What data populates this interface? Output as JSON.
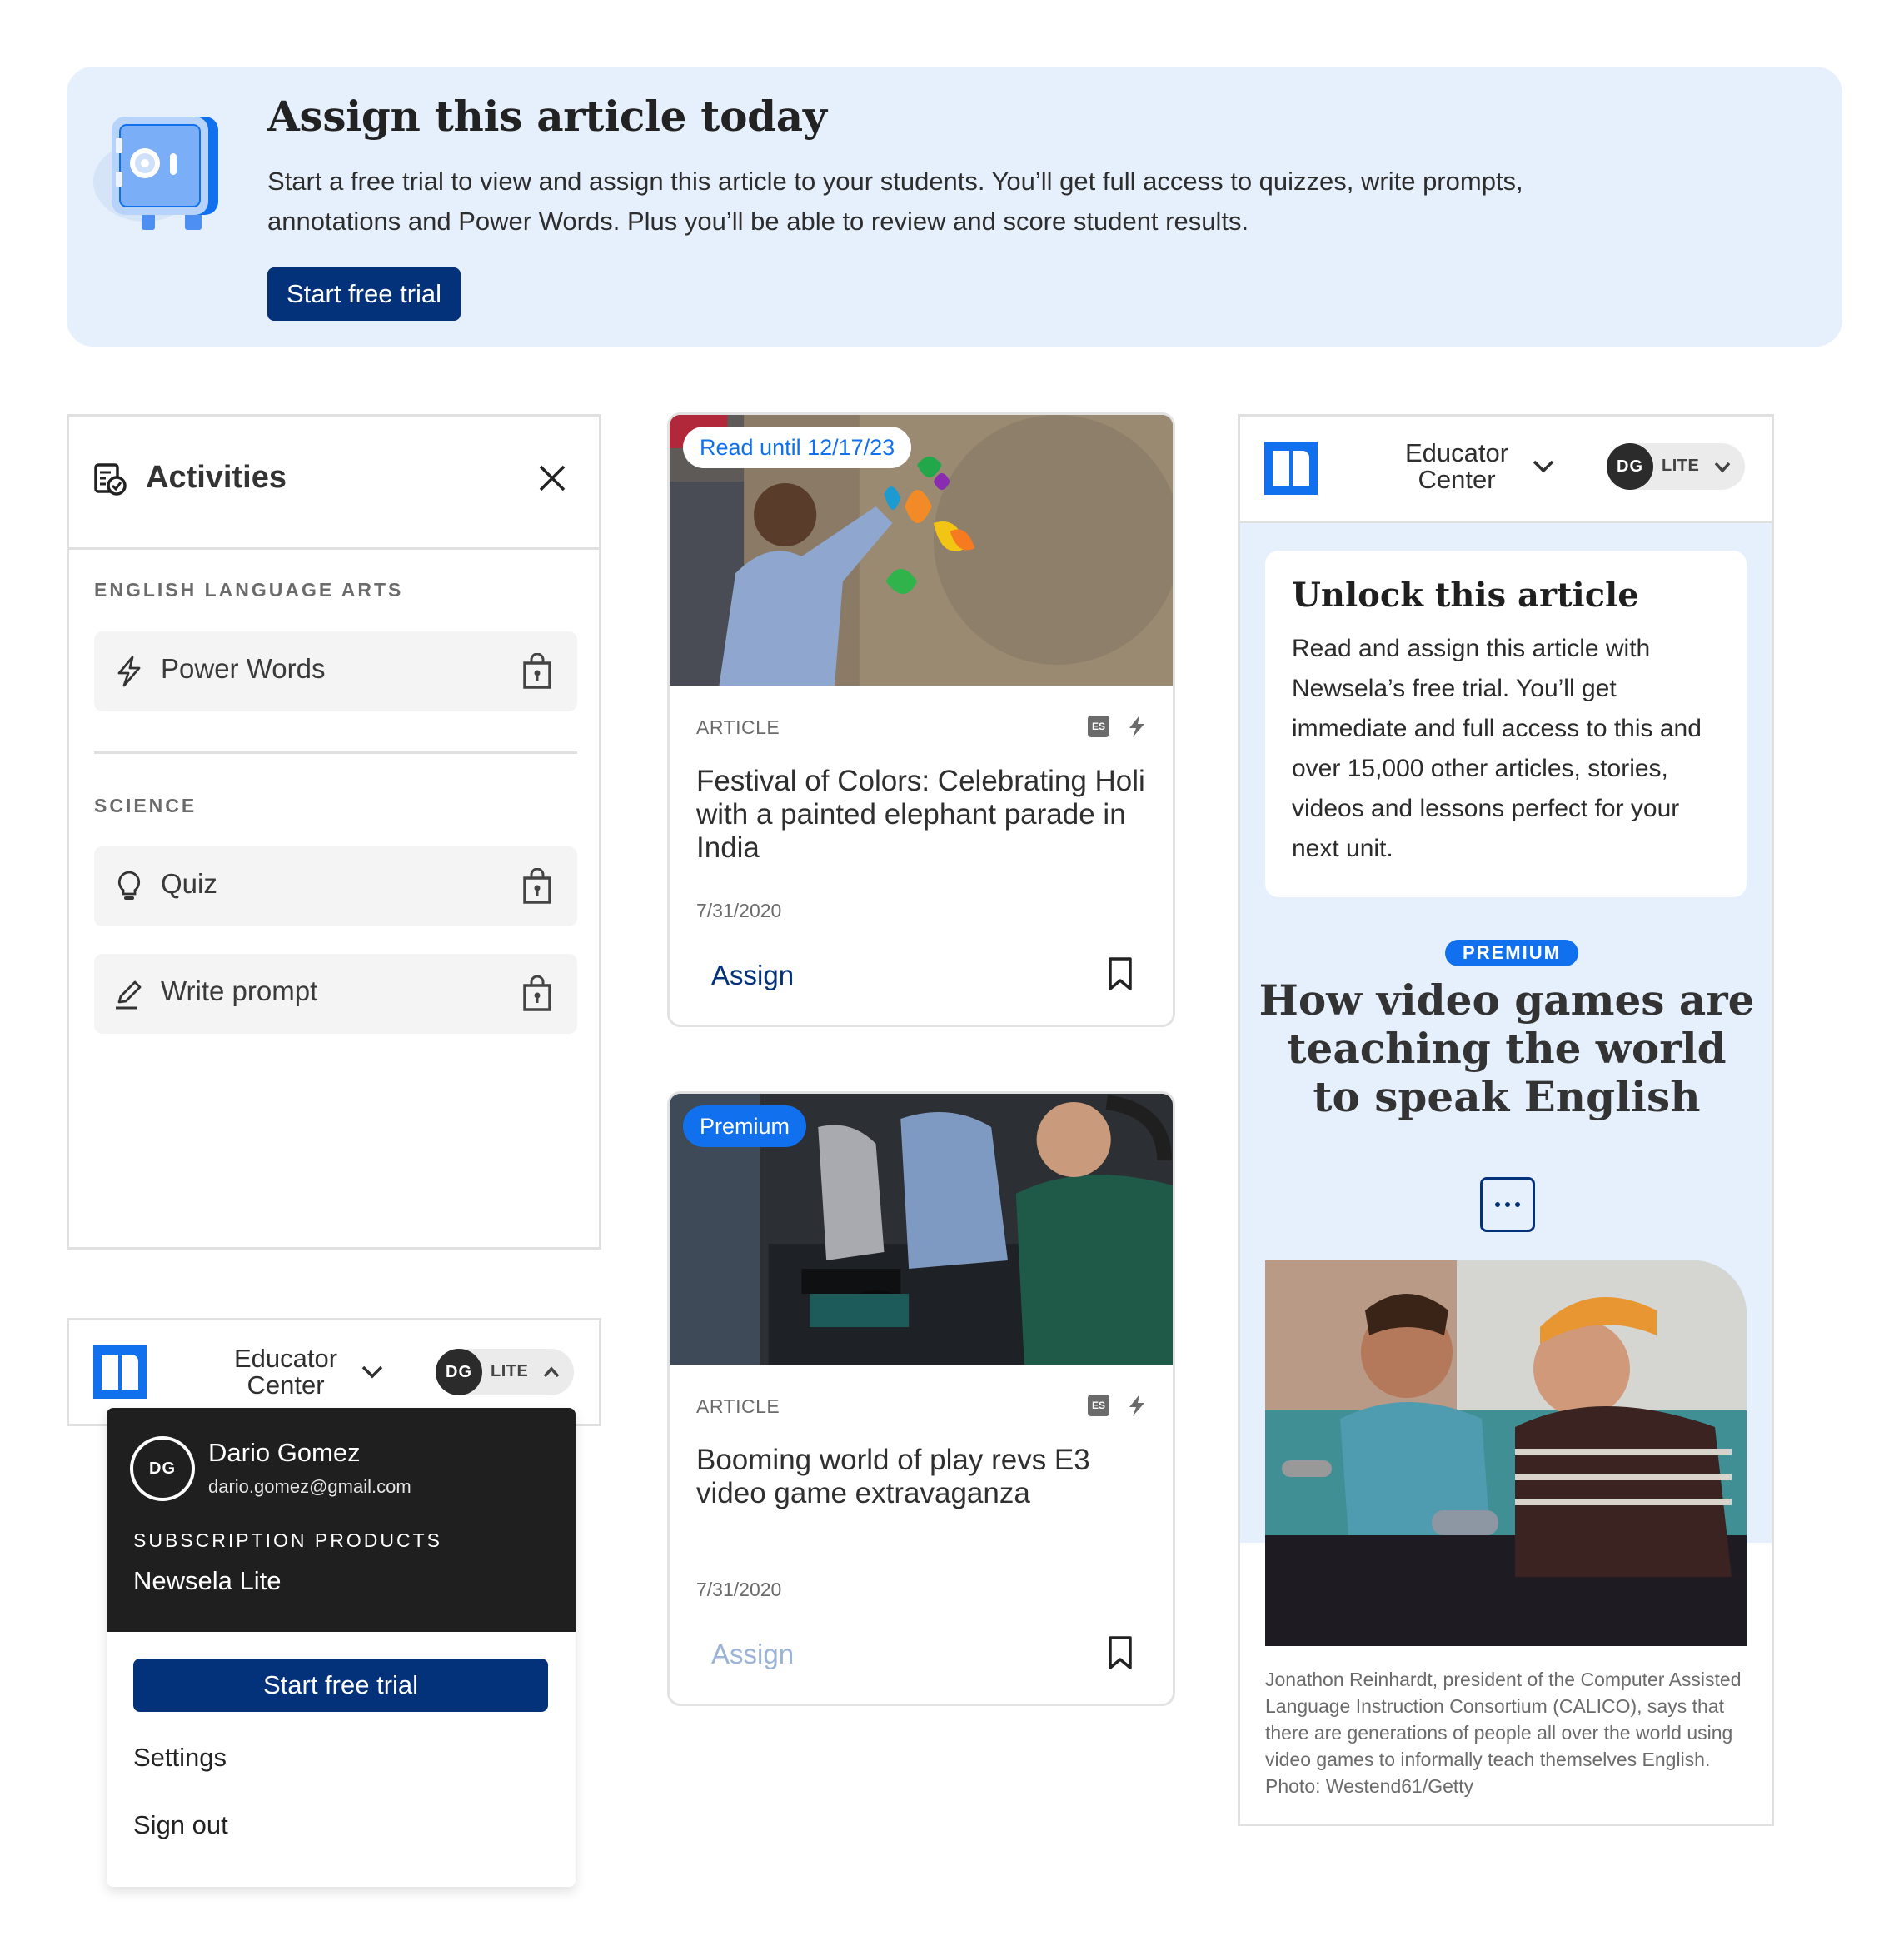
{
  "banner": {
    "title": "Assign this article today",
    "body": "Start a free trial to view and assign this article to your students. You’ll get full access to quizzes, write prompts, annotations and Power Words. Plus you’ll be able to review and score student results.",
    "button_label": "Start free trial",
    "icon": "safe-icon"
  },
  "activities": {
    "title": "Activities",
    "sections": [
      {
        "label": "ENGLISH LANGUAGE ARTS",
        "items": [
          {
            "label": "Power Words",
            "icon": "bolt-icon",
            "locked": true
          }
        ]
      },
      {
        "label": "SCIENCE",
        "items": [
          {
            "label": "Quiz",
            "icon": "lightbulb-icon",
            "locked": true
          },
          {
            "label": "Write prompt",
            "icon": "pencil-icon",
            "locked": true
          }
        ]
      }
    ]
  },
  "cards": [
    {
      "badge": "Read until 12/17/23",
      "kind": "ARTICLE",
      "lang_badge": "ES",
      "title": "Festival of Colors: Celebrating Holi with a painted elephant parade in India",
      "date": "7/31/2020",
      "assign_label": "Assign",
      "assign_enabled": true
    },
    {
      "badge": "Premium",
      "kind": "ARTICLE",
      "lang_badge": "ES",
      "title": "Booming world of play revs E3 video game extravaganza",
      "date": "7/31/2020",
      "assign_label": "Assign",
      "assign_enabled": false
    }
  ],
  "header": {
    "center_line1": "Educator",
    "center_line2": "Center",
    "initials": "DG",
    "plan": "LITE"
  },
  "account_menu": {
    "initials": "DG",
    "name": "Dario Gomez",
    "email": "dario.gomez@gmail.com",
    "subscription_label": "SUBSCRIPTION PRODUCTS",
    "product": "Newsela Lite",
    "trial_button": "Start free trial",
    "settings": "Settings",
    "sign_out": "Sign out"
  },
  "article_panel": {
    "unlock_title": "Unlock this article",
    "unlock_body": "Read and assign this article with Newsela’s free trial. You’ll get immediate and full access to this and over 15,000 other articles, stories, videos and lessons perfect for your next unit.",
    "premium_badge": "PREMIUM",
    "headline": "How video games are teaching the world to speak English",
    "caption": "Jonathon Reinhardt, president of the Computer Assisted Language Instruction Consortium (CALICO), says that there are generations of people all over the world using video games to informally teach themselves English. Photo: Westend61/Getty"
  },
  "colors": {
    "brand_blue": "#1170ee",
    "navy_button": "#04327a",
    "banner_bg": "#e6f0fd",
    "disabled_assign": "#9bb3d6"
  }
}
